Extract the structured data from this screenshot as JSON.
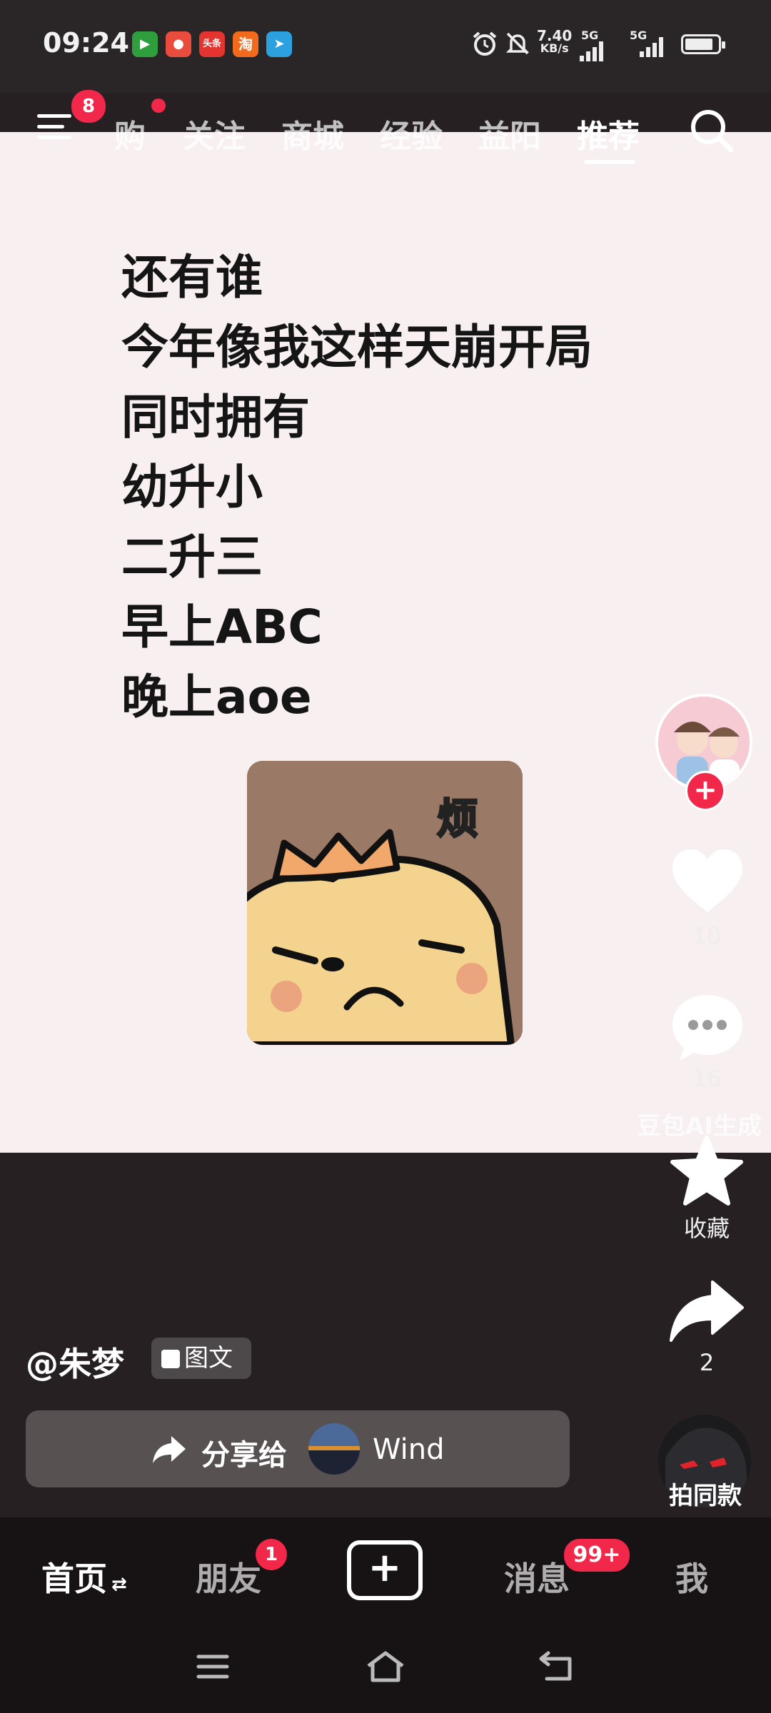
{
  "status_bar": {
    "time": "09:24",
    "speed_value": "7.40",
    "speed_unit": "KB/s",
    "sim1": "5G",
    "sim2": "5G",
    "app_icons": [
      "video-app-icon",
      "app-icon-2",
      "toutiao-icon",
      "taobao-icon",
      "telegram-icon"
    ],
    "toutiao_label": "头条",
    "taobao_label": "淘"
  },
  "top_nav": {
    "menu_badge": "8",
    "tabs": [
      "购",
      "关注",
      "商城",
      "经验",
      "益阳",
      "推荐"
    ],
    "active_tab": "推荐"
  },
  "post": {
    "lines": [
      "还有谁",
      "今年像我这样天崩开局",
      "同时拥有",
      "幼升小",
      "二升三",
      "早上ABC",
      "晚上aoe"
    ],
    "sticker_text": "烦",
    "watermark": "豆包AI生成"
  },
  "actions": {
    "like_count": "10",
    "comment_count": "16",
    "favorite_label": "收藏",
    "share_count": "2",
    "same_style_label": "拍同款"
  },
  "author": {
    "name": "@朱梦",
    "tag": "图文"
  },
  "share_bar": {
    "label": "分享给",
    "recipient": "Wind"
  },
  "bottom_tabs": {
    "home": "首页",
    "friends": "朋友",
    "friends_badge": "1",
    "messages": "消息",
    "messages_badge": "99+",
    "me": "我"
  },
  "colors": {
    "badge_red": "#f2284b",
    "post_bg": "#f7eff0",
    "sticker_bg": "#9a7a66",
    "tab_bar_bg": "#171314"
  }
}
